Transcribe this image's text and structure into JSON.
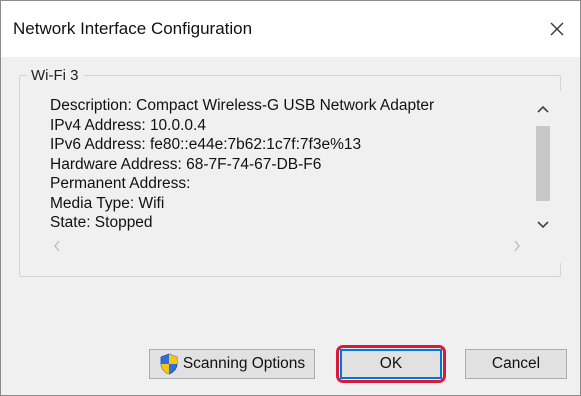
{
  "window": {
    "title": "Network Interface Configuration",
    "close_icon": "close-icon"
  },
  "group": {
    "legend": "Wi-Fi 3"
  },
  "details": {
    "lines": [
      "Description: Compact Wireless-G USB Network Adapter",
      "IPv4 Address: 10.0.0.4",
      "IPv6 Address: fe80::e44e:7b62:1c7f:7f3e%13",
      "Hardware Address: 68-7F-74-67-DB-F6",
      "Permanent Address:",
      "Media Type: Wifi",
      "State: Stopped"
    ]
  },
  "buttons": {
    "scanning_options": "Scanning Options",
    "ok": "OK",
    "cancel": "Cancel"
  },
  "colors": {
    "highlight": "#d81b3c",
    "focus": "#0078d7",
    "shield_blue": "#2e6fd8",
    "shield_yellow": "#f5c518"
  }
}
